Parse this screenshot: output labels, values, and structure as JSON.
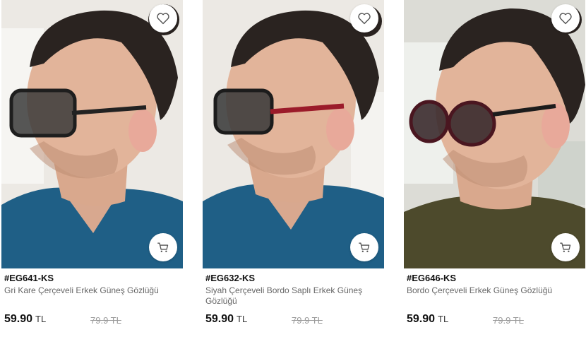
{
  "products": [
    {
      "code": "#EG641-KS",
      "name": "Gri Kare Çerçeveli Erkek Güneş Gözlüğü",
      "price": "59.90",
      "currency": "TL",
      "old_price": "79.9 TL",
      "frame_color": "#2b2b2b",
      "temple_color": "#222222",
      "shirt_color": "#1f5f86",
      "fav_icon": "heart-outline-icon",
      "cart_icon": "shopping-cart-icon"
    },
    {
      "code": "#EG632-KS",
      "name": "Siyah Çerçeveli Bordo Saplı Erkek Güneş Gözlüğü",
      "price": "59.90",
      "currency": "TL",
      "old_price": "79.9 TL",
      "frame_color": "#1c1c1c",
      "temple_color": "#9b1b2a",
      "shirt_color": "#1f5f86",
      "fav_icon": "heart-outline-icon",
      "cart_icon": "shopping-cart-icon"
    },
    {
      "code": "#EG646-KS",
      "name": "Bordo Çerçeveli Erkek Güneş Gözlüğü",
      "price": "59.90",
      "currency": "TL",
      "old_price": "79.9 TL",
      "frame_color": "#4a1620",
      "temple_color": "#1c1c1c",
      "shirt_color": "#4d4a2c",
      "fav_icon": "heart-outline-icon",
      "cart_icon": "shopping-cart-icon"
    }
  ]
}
